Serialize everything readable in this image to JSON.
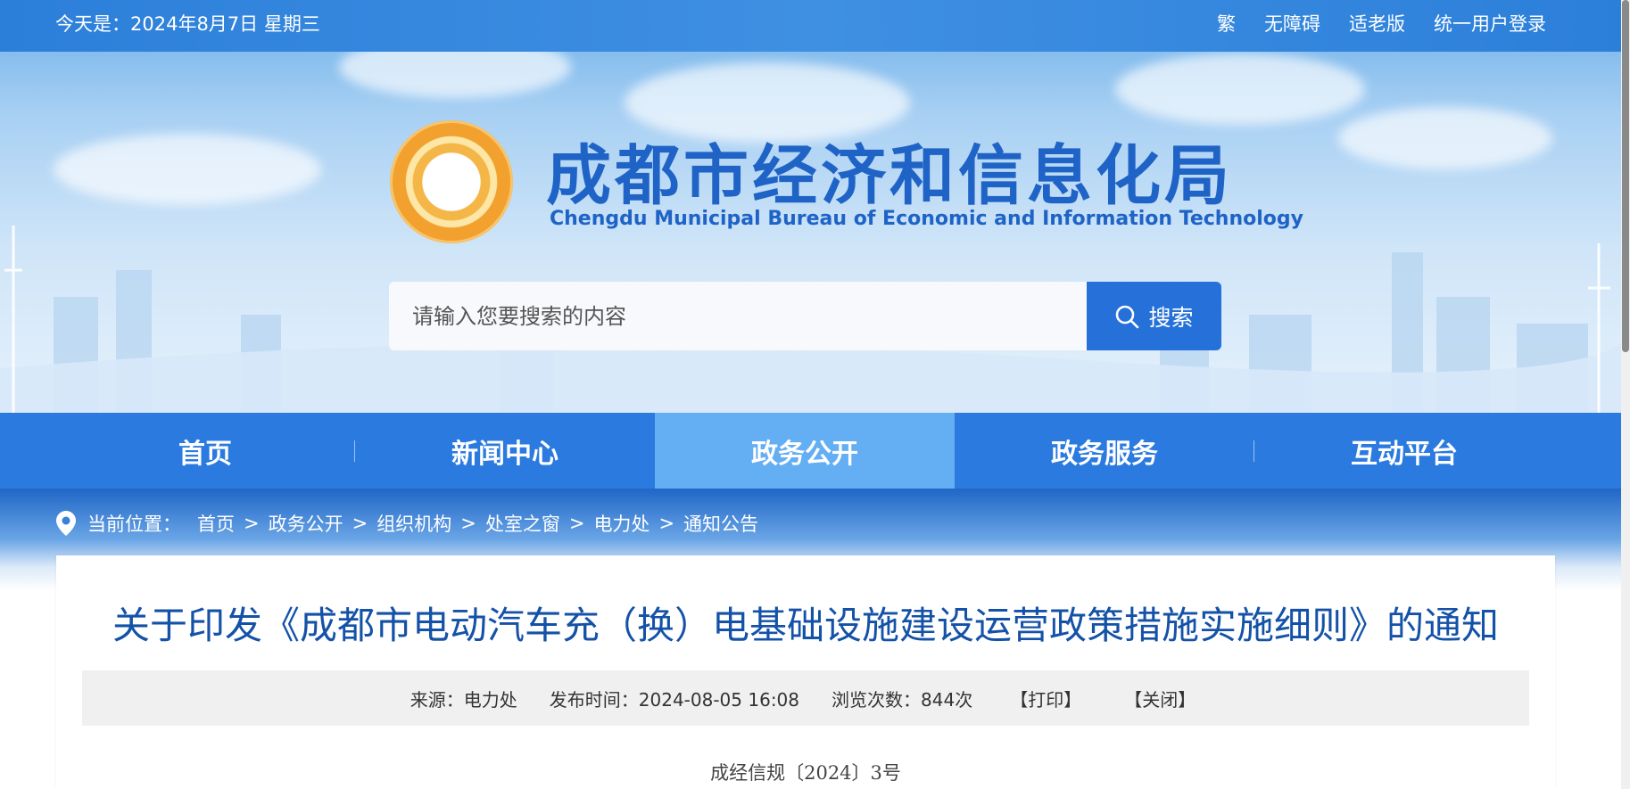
{
  "topbar": {
    "date_text": "今天是：2024年8月7日  星期三",
    "links": [
      "繁",
      "无障碍",
      "适老版",
      "统一用户登录"
    ]
  },
  "header": {
    "title_cn": "成都市经济和信息化局",
    "title_en": "Chengdu Municipal Bureau of Economic and Information Technology",
    "logo_icon": "emblem-logo-icon"
  },
  "search": {
    "placeholder": "请输入您要搜索的内容",
    "button_label": "搜索",
    "icon": "search-icon"
  },
  "nav": {
    "items": [
      "首页",
      "新闻中心",
      "政务公开",
      "政务服务",
      "互动平台"
    ],
    "active": "政务公开"
  },
  "breadcrumb": {
    "label": "当前位置：",
    "items": [
      "首页",
      "政务公开",
      "组织机构",
      "处室之窗",
      "电力处",
      "通知公告"
    ],
    "separator": ">",
    "icon": "location-pin-icon"
  },
  "article": {
    "title": "关于印发《成都市电动汽车充（换）电基础设施建设运营政策措施实施细则》的通知",
    "source": "来源：电力处",
    "publish_time": "发布时间：2024-08-05 16:08",
    "views": "浏览次数：844次",
    "print_label": "【打印】",
    "close_label": "【关闭】",
    "doc_number": "成经信规〔2024〕3号"
  },
  "colors": {
    "topbar": "#2c7fd9",
    "nav": "#2a7ae0",
    "nav_active": "#64aef3",
    "title_blue": "#1452a8",
    "search_button": "#2671d9"
  }
}
